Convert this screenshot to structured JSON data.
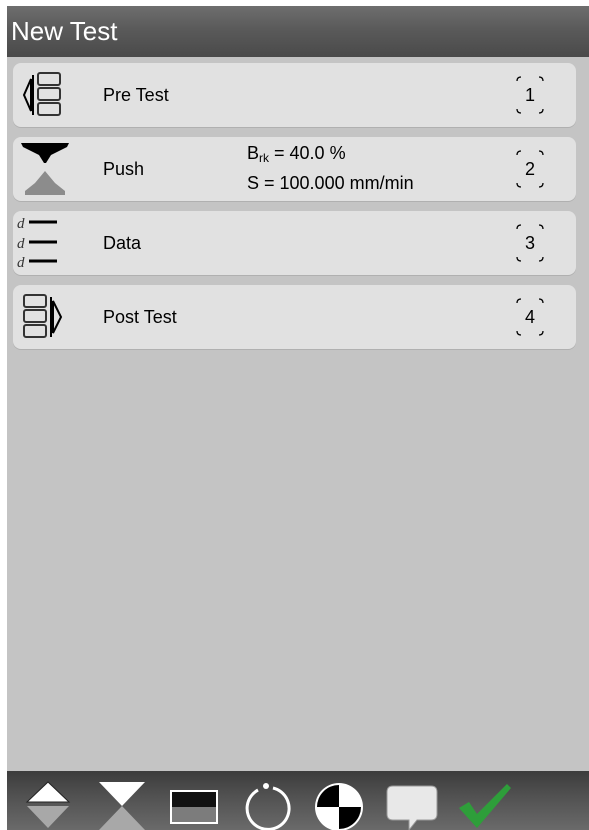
{
  "window": {
    "title": "New Test"
  },
  "steps": [
    {
      "label": "Pre Test",
      "number": "1",
      "icon": "pre-test-icon"
    },
    {
      "label": "Push",
      "number": "2",
      "icon": "push-icon",
      "param1_symbol": "B",
      "param1_sub": "rk",
      "param1_value": " = 40.0 %",
      "param2": "S = 100.000 mm/min"
    },
    {
      "label": "Data",
      "number": "3",
      "icon": "data-icon",
      "icon_letters": [
        "d",
        "d",
        "d"
      ]
    },
    {
      "label": "Post Test",
      "number": "4",
      "icon": "post-test-icon"
    }
  ],
  "toolbar": {
    "buttons": [
      "move-up-down-icon",
      "hourglass-icon",
      "panel-icon",
      "refresh-circle-icon",
      "quadrant-target-icon",
      "speech-bubble-icon",
      "checkmark-icon"
    ],
    "accent": "#2e9e3a"
  },
  "colors": {
    "background": "#c4c4c4",
    "row": "#e1e1e1",
    "title_text": "#ffffff"
  }
}
